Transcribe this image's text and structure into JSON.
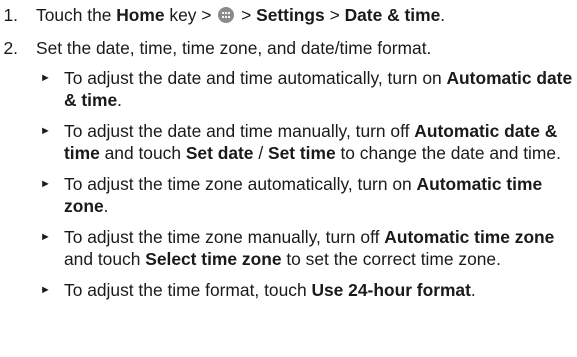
{
  "steps": [
    {
      "number": "1.",
      "parts": {
        "t1": "Touch the ",
        "b1": "Home",
        "t2": " key > ",
        "t3": " > ",
        "b2": "Settings",
        "t4": " > ",
        "b3": "Date & time",
        "t5": "."
      }
    },
    {
      "number": "2.",
      "text": "Set the date, time, time zone, and date/time format."
    }
  ],
  "icons": {
    "apps": "apps-icon",
    "apps_color": "#8a8a8a"
  },
  "bullets": [
    {
      "mark": "►",
      "t1": "To adjust the date and time automatically, turn on ",
      "b1": "Automatic date & time",
      "t2": "."
    },
    {
      "mark": "►",
      "t1": "To adjust the date and time manually, turn off ",
      "b1": "Automatic date & time",
      "t2": " and touch ",
      "b2": "Set date",
      "t3": " / ",
      "b3": "Set time",
      "t4": " to change the date and time."
    },
    {
      "mark": "►",
      "t1": "To adjust the time zone automatically, turn on ",
      "b1": "Automatic time zone",
      "t2": "."
    },
    {
      "mark": "►",
      "t1": "To adjust the time zone manually, turn off ",
      "b1": "Automatic time zone",
      "t2": " and touch ",
      "b2": "Select time zone",
      "t3": " to set the correct time zone."
    },
    {
      "mark": "►",
      "t1": "To adjust the time format, touch ",
      "b1": "Use 24-hour format",
      "t2": "."
    }
  ]
}
